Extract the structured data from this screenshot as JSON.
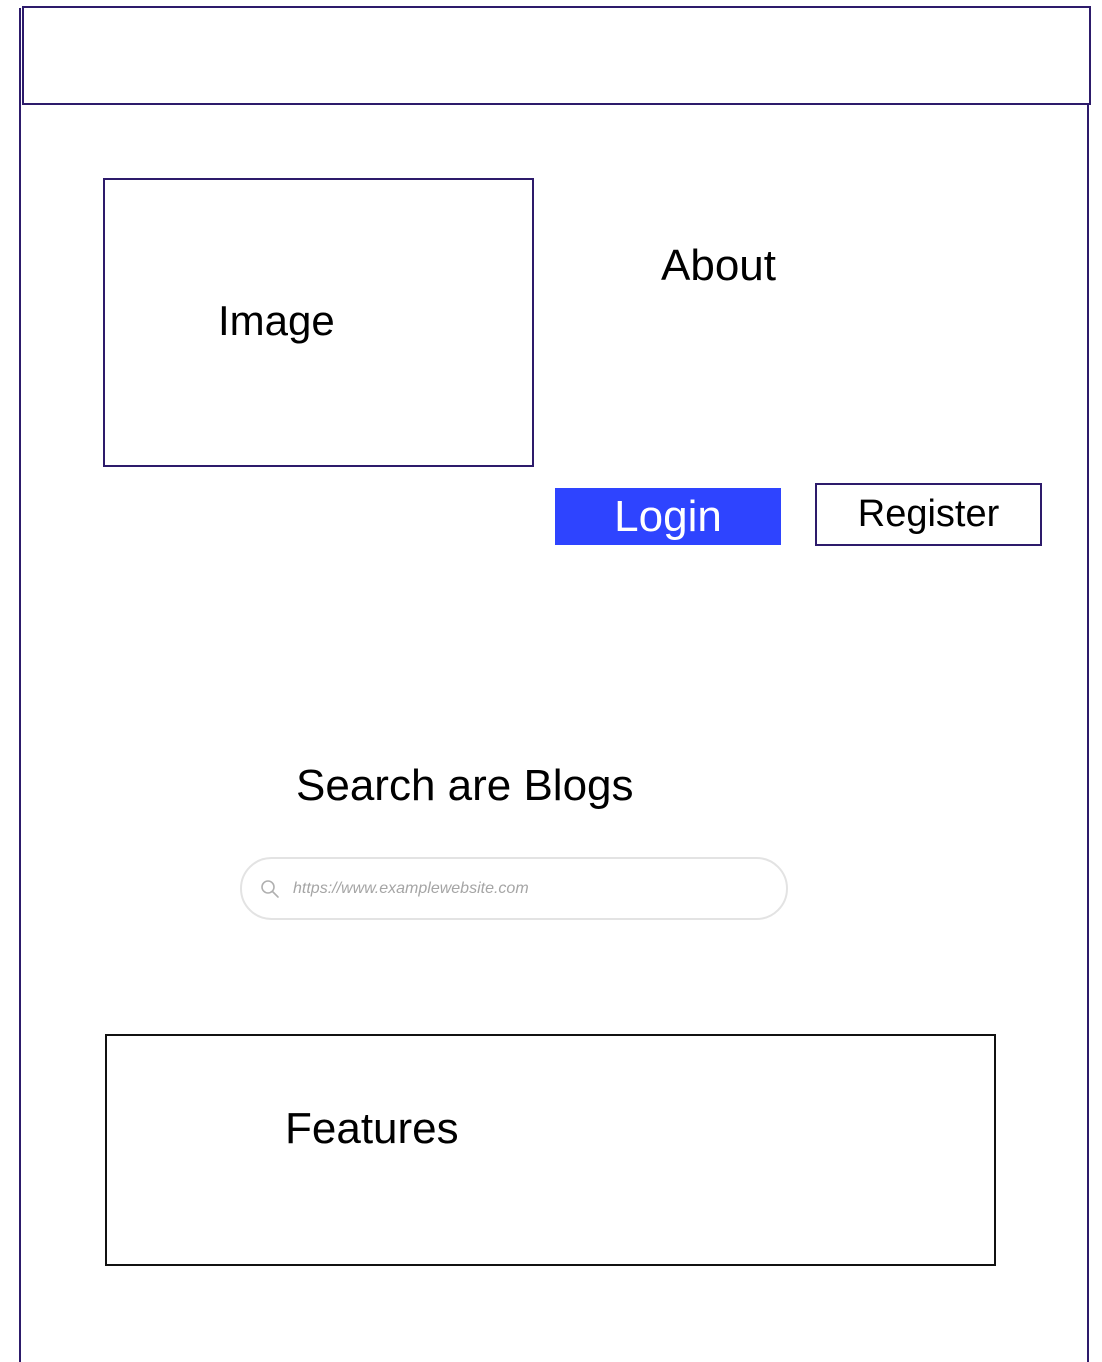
{
  "image_placeholder": {
    "label": "Image"
  },
  "about": {
    "label": "About"
  },
  "auth": {
    "login_label": "Login",
    "register_label": "Register"
  },
  "search": {
    "heading": "Search are Blogs",
    "placeholder": "https://www.examplewebsite.com",
    "icon": "search-icon"
  },
  "features": {
    "label": "Features"
  },
  "colors": {
    "accent": "#2e44ff",
    "border": "#2d1b6b",
    "search_border": "#e3e3e3",
    "placeholder_text": "#a5a5a5"
  }
}
